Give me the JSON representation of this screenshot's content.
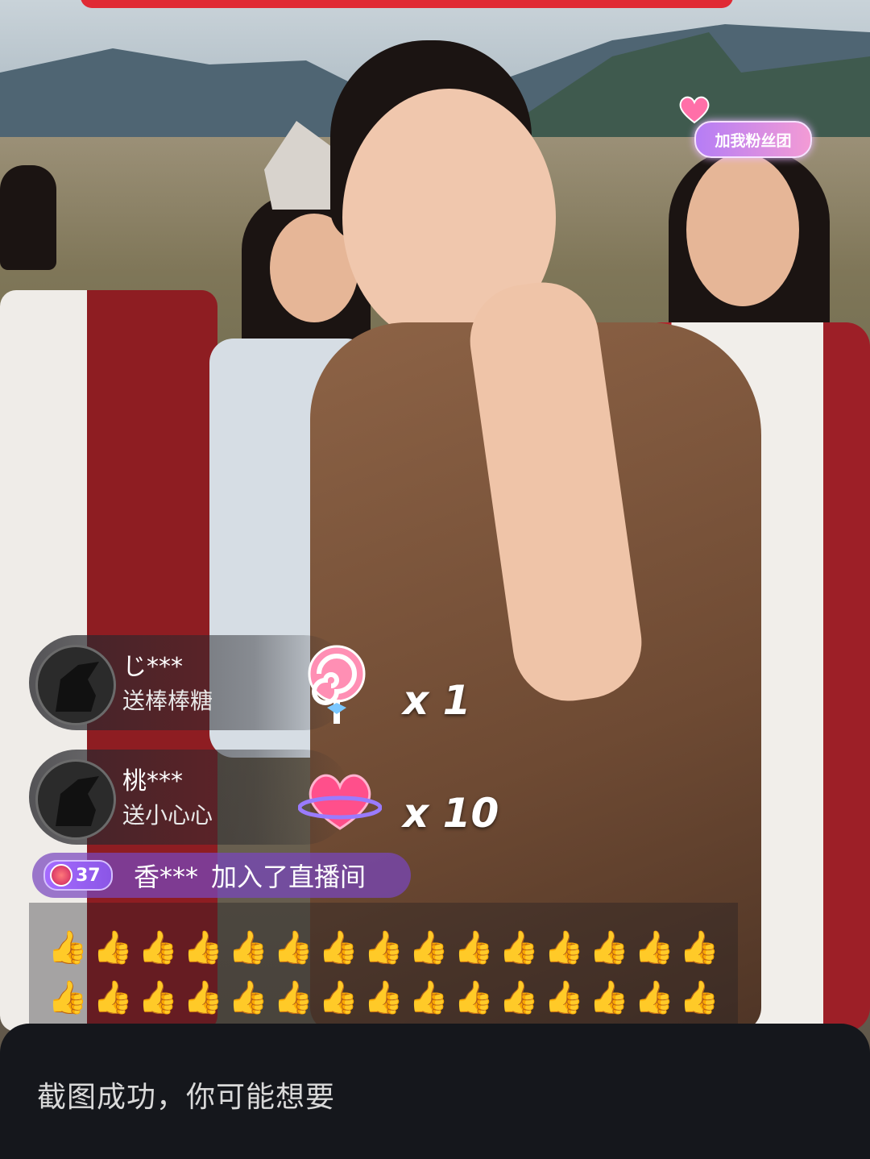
{
  "gifts": [
    {
      "user": "じ***",
      "action": "送棒棒糖",
      "gift_icon": "lollipop-icon",
      "count": "x 1"
    },
    {
      "user": "桃***",
      "action": "送小心心",
      "gift_icon": "heart-planet-icon",
      "count": "x 10"
    }
  ],
  "join_message": {
    "level": "37",
    "user": "香***",
    "text": "加入了直播间"
  },
  "fan_group_badge": "加我粉丝团",
  "reactions": {
    "icon": "thumbs-up-icon",
    "glyph": "👍",
    "per_row": 15,
    "rows": 2
  },
  "toast": {
    "text": "截图成功，你可能想要"
  },
  "colors": {
    "join_bg": "#7846be",
    "toast_bg": "#15171c",
    "banner": "#e02a34"
  }
}
